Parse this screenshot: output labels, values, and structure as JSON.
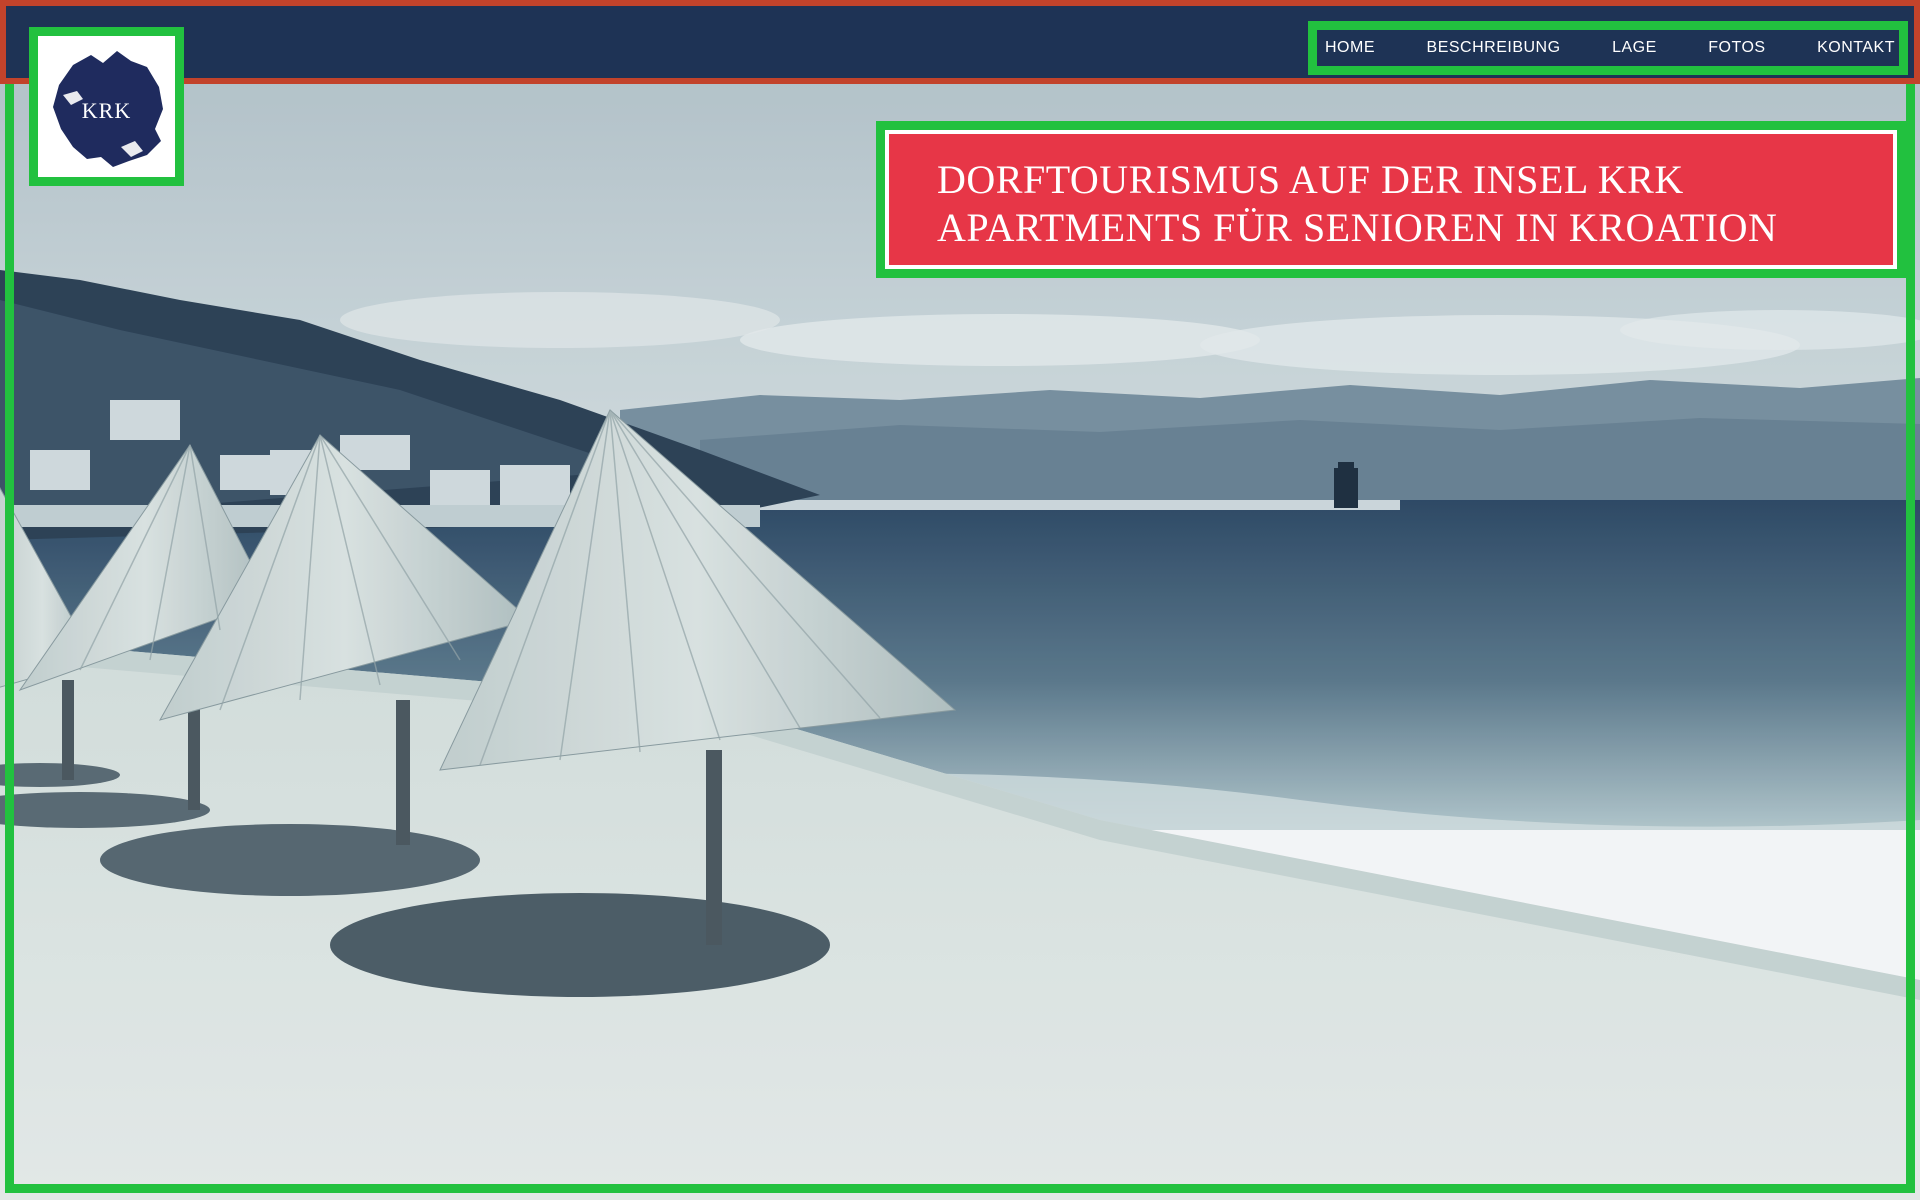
{
  "nav": {
    "items": [
      {
        "label": "HOME"
      },
      {
        "label": "BESCHREIBUNG"
      },
      {
        "label": "LAGE"
      },
      {
        "label": "FOTOS"
      },
      {
        "label": "KONTAKT"
      }
    ]
  },
  "logo": {
    "text": "KRK",
    "icon": "island-map-logo"
  },
  "hero": {
    "headline_line1": "DORFTOURISMUS AUF DER INSEL KRK",
    "headline_line2": "APARTMENTS FÜR SENIOREN IN KROATION",
    "image": "beach-with-thatched-umbrellas-photo"
  },
  "colors": {
    "header_bg": "#1e3355",
    "headline_bg": "#e73647",
    "annotation_green": "#22c13f",
    "annotation_red": "#c2432b"
  }
}
